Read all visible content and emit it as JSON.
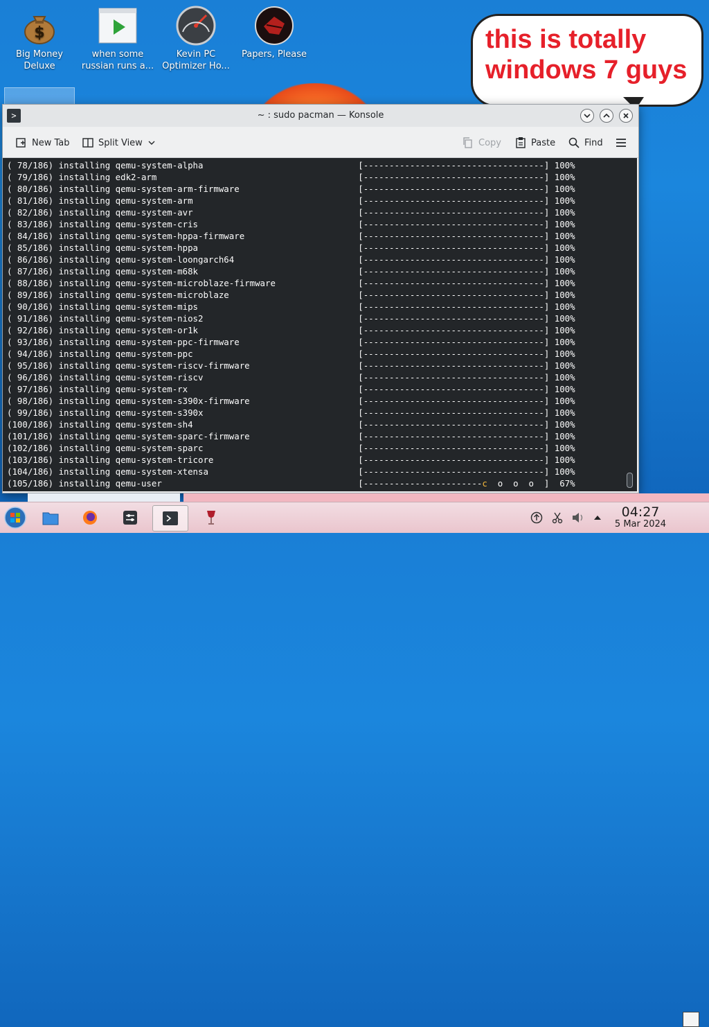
{
  "desktop": {
    "icons": [
      {
        "label": "Big Money\nDeluxe",
        "name": "big-money-deluxe-icon"
      },
      {
        "label": "when some\nrussian runs a...",
        "name": "when-some-russian-icon"
      },
      {
        "label": "Kevin PC\nOptimizer Ho...",
        "name": "kevin-pc-optimizer-icon"
      },
      {
        "label": "Papers, Please",
        "name": "papers-please-icon"
      }
    ]
  },
  "bubble": {
    "text": "this is totally windows 7 guys",
    "color": "#e6202a"
  },
  "window": {
    "title": "~ : sudo pacman — Konsole",
    "toolbar": {
      "new_tab": "New Tab",
      "split_view": "Split View",
      "copy": "Copy",
      "paste": "Paste",
      "find": "Find"
    }
  },
  "terminal": {
    "lines": [
      "( 78/186) installing qemu-system-alpha                              [-----------------------------------] 100%",
      "( 79/186) installing edk2-arm                                       [-----------------------------------] 100%",
      "( 80/186) installing qemu-system-arm-firmware                       [-----------------------------------] 100%",
      "( 81/186) installing qemu-system-arm                                [-----------------------------------] 100%",
      "( 82/186) installing qemu-system-avr                                [-----------------------------------] 100%",
      "( 83/186) installing qemu-system-cris                               [-----------------------------------] 100%",
      "( 84/186) installing qemu-system-hppa-firmware                      [-----------------------------------] 100%",
      "( 85/186) installing qemu-system-hppa                               [-----------------------------------] 100%",
      "( 86/186) installing qemu-system-loongarch64                        [-----------------------------------] 100%",
      "( 87/186) installing qemu-system-m68k                               [-----------------------------------] 100%",
      "( 88/186) installing qemu-system-microblaze-firmware                [-----------------------------------] 100%",
      "( 89/186) installing qemu-system-microblaze                         [-----------------------------------] 100%",
      "( 90/186) installing qemu-system-mips                               [-----------------------------------] 100%",
      "( 91/186) installing qemu-system-nios2                              [-----------------------------------] 100%",
      "( 92/186) installing qemu-system-or1k                               [-----------------------------------] 100%",
      "( 93/186) installing qemu-system-ppc-firmware                       [-----------------------------------] 100%",
      "( 94/186) installing qemu-system-ppc                                [-----------------------------------] 100%",
      "( 95/186) installing qemu-system-riscv-firmware                     [-----------------------------------] 100%",
      "( 96/186) installing qemu-system-riscv                              [-----------------------------------] 100%",
      "( 97/186) installing qemu-system-rx                                 [-----------------------------------] 100%",
      "( 98/186) installing qemu-system-s390x-firmware                     [-----------------------------------] 100%",
      "( 99/186) installing qemu-system-s390x                              [-----------------------------------] 100%",
      "(100/186) installing qemu-system-sh4                                [-----------------------------------] 100%",
      "(101/186) installing qemu-system-sparc-firmware                     [-----------------------------------] 100%",
      "(102/186) installing qemu-system-sparc                              [-----------------------------------] 100%",
      "(103/186) installing qemu-system-tricore                            [-----------------------------------] 100%",
      "(104/186) installing qemu-system-xtensa                             [-----------------------------------] 100%"
    ],
    "last_line_prefix": "(105/186) installing qemu-user                                      [-----------------------",
    "last_line_pacman": "c",
    "last_line_suffix": "  o  o  o  ]  67%"
  },
  "taskbar": {
    "time": "04:27",
    "date": "5 Mar 2024"
  }
}
